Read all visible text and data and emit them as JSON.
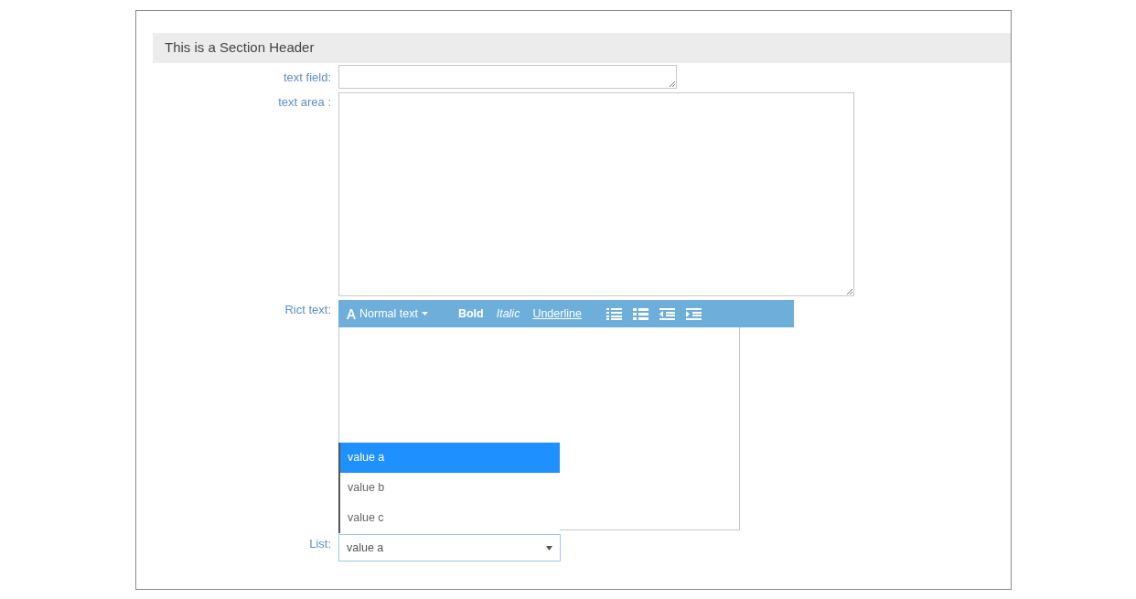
{
  "section_header": "This is a Section Header",
  "text_field": {
    "label": "text field:"
  },
  "text_area": {
    "label": "text area :"
  },
  "rich_text": {
    "label": "Rict text:",
    "style_menu": "Normal text",
    "buttons": [
      {
        "kind": "bold",
        "label": "Bold"
      },
      {
        "kind": "italic",
        "label": "Italic"
      },
      {
        "kind": "underline",
        "label": "Underline"
      }
    ]
  },
  "list": {
    "label": "List:",
    "value": "value a",
    "expanded": true,
    "options": [
      {
        "label": "value a",
        "selected": true
      },
      {
        "label": "value b",
        "selected": false
      },
      {
        "label": "value c",
        "selected": false
      }
    ]
  }
}
